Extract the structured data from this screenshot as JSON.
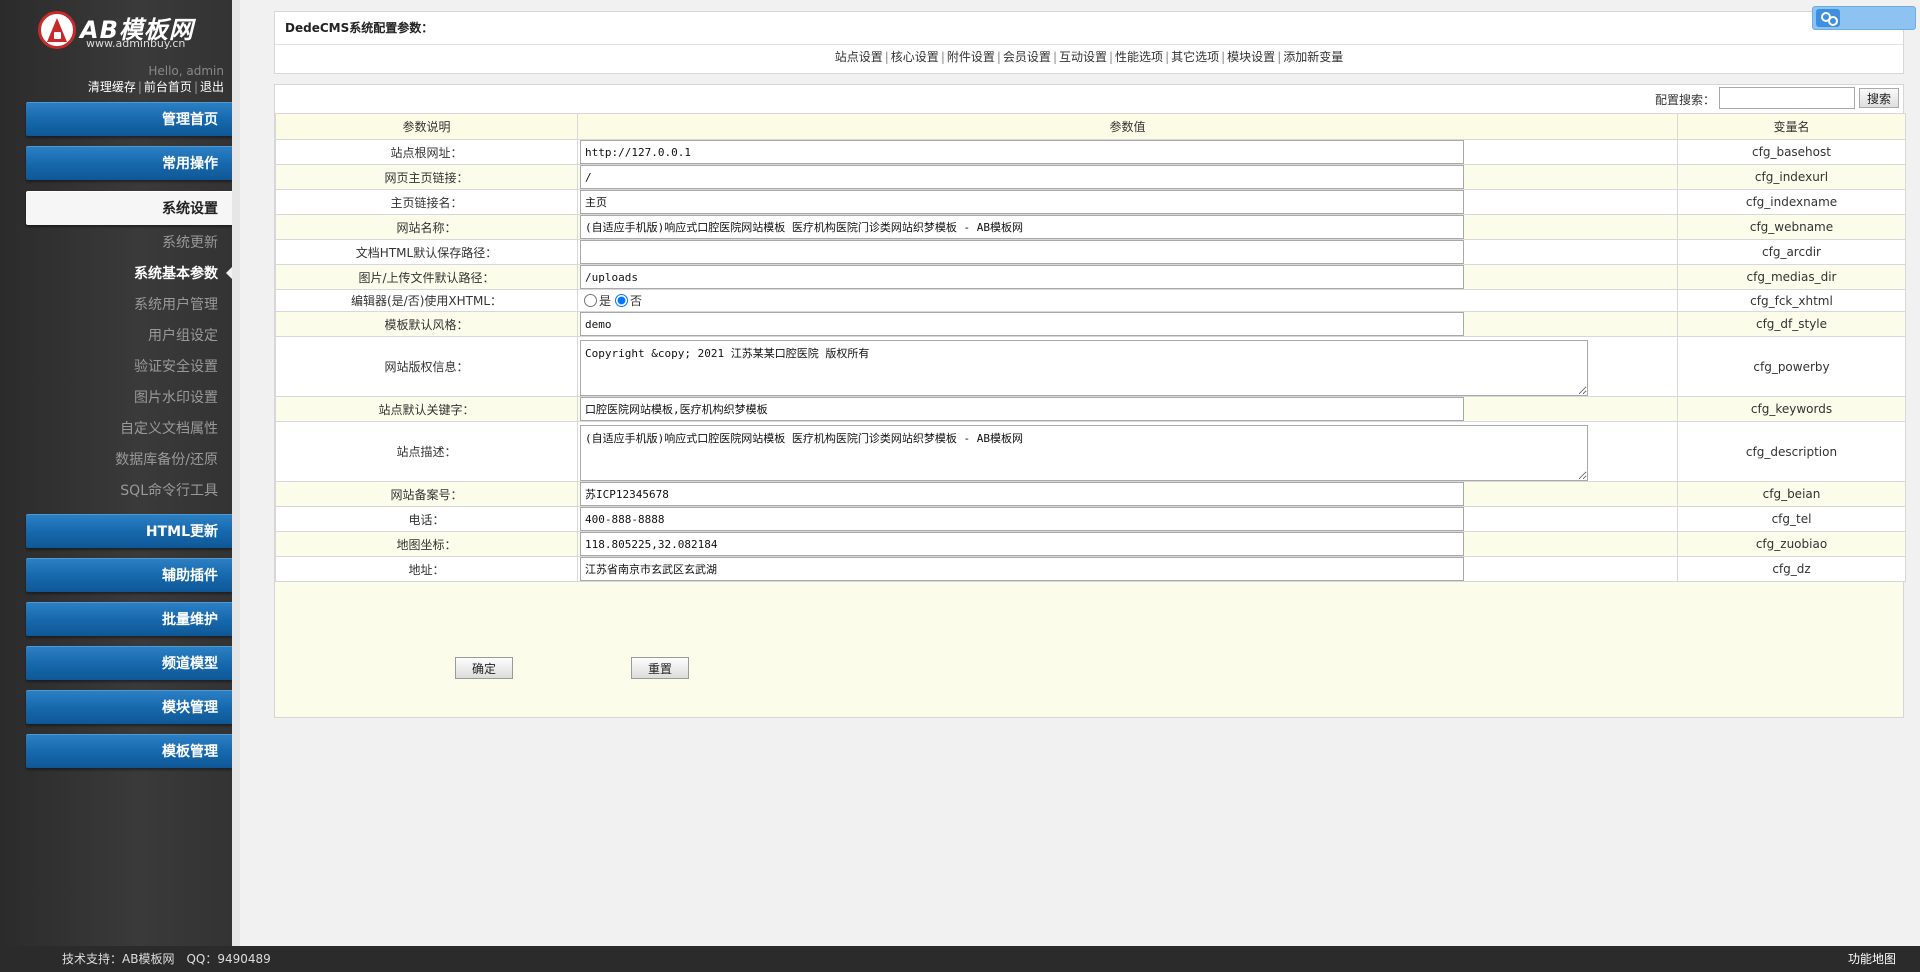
{
  "brand": {
    "title": "AB模板网",
    "url": "www.adminbuy.cn"
  },
  "user": {
    "hello": "Hello, admin",
    "links": [
      "清理缓存",
      "前台首页",
      "退出"
    ]
  },
  "menu": {
    "home": "管理首页",
    "common": "常用操作",
    "system": "系统设置",
    "html": "HTML更新",
    "plugins": "辅助插件",
    "batch": "批量维护",
    "channel": "频道模型",
    "module": "模块管理",
    "template": "模板管理"
  },
  "submenu": [
    "系统更新",
    "系统基本参数",
    "系统用户管理",
    "用户组设定",
    "验证安全设置",
    "图片水印设置",
    "自定义文档属性",
    "数据库备份/还原",
    "SQL命令行工具"
  ],
  "config": {
    "title": "DedeCMS系统配置参数：",
    "tabs": [
      "站点设置",
      "核心设置",
      "附件设置",
      "会员设置",
      "互动设置",
      "性能选项",
      "其它选项",
      "模块设置",
      "添加新变量"
    ],
    "search_label": "配置搜索：",
    "search_value": "",
    "search_button": "搜索",
    "columns": [
      "参数说明",
      "参数值",
      "变量名"
    ],
    "rows": [
      {
        "desc": "站点根网址：",
        "value": "http://127.0.0.1",
        "var": "cfg_basehost",
        "kind": "text"
      },
      {
        "desc": "网页主页链接：",
        "value": "/",
        "var": "cfg_indexurl",
        "kind": "text"
      },
      {
        "desc": "主页链接名：",
        "value": "主页",
        "var": "cfg_indexname",
        "kind": "text"
      },
      {
        "desc": "网站名称：",
        "value": "(自适应手机版)响应式口腔医院网站模板 医疗机构医院门诊类网站织梦模板 - AB模板网",
        "var": "cfg_webname",
        "kind": "text"
      },
      {
        "desc": "文档HTML默认保存路径：",
        "value": "",
        "var": "cfg_arcdir",
        "kind": "text"
      },
      {
        "desc": "图片/上传文件默认路径：",
        "value": "/uploads",
        "var": "cfg_medias_dir",
        "kind": "text"
      },
      {
        "desc": "编辑器(是/否)使用XHTML：",
        "var": "cfg_fck_xhtml",
        "kind": "radio",
        "options": [
          "是",
          "否"
        ],
        "selected": "否"
      },
      {
        "desc": "模板默认风格：",
        "value": "demo",
        "var": "cfg_df_style",
        "kind": "text"
      },
      {
        "desc": "网站版权信息：",
        "value": "Copyright &copy; 2021 江苏某某口腔医院 版权所有",
        "var": "cfg_powerby",
        "kind": "textarea"
      },
      {
        "desc": "站点默认关键字：",
        "value": "口腔医院网站模板,医疗机构织梦模板",
        "var": "cfg_keywords",
        "kind": "text"
      },
      {
        "desc": "站点描述：",
        "value": "(自适应手机版)响应式口腔医院网站模板 医疗机构医院门诊类网站织梦模板 - AB模板网",
        "var": "cfg_description",
        "kind": "textarea"
      },
      {
        "desc": "网站备案号：",
        "value": "苏ICP12345678",
        "var": "cfg_beian",
        "kind": "text"
      },
      {
        "desc": "电话：",
        "value": "400-888-8888",
        "var": "cfg_tel",
        "kind": "text"
      },
      {
        "desc": "地图坐标：",
        "value": "118.805225,32.082184",
        "var": "cfg_zuobiao",
        "kind": "text"
      },
      {
        "desc": "地址：",
        "value": "江苏省南京市玄武区玄武湖",
        "var": "cfg_dz",
        "kind": "text"
      }
    ],
    "submit": "确定",
    "reset": "重置"
  },
  "footer": {
    "support": "技术支持：AB模板网　QQ：9490489",
    "sitemap": "功能地图"
  },
  "colors": {
    "menu_blue": "#1769ad",
    "panel_bg": "#fbfcea"
  }
}
